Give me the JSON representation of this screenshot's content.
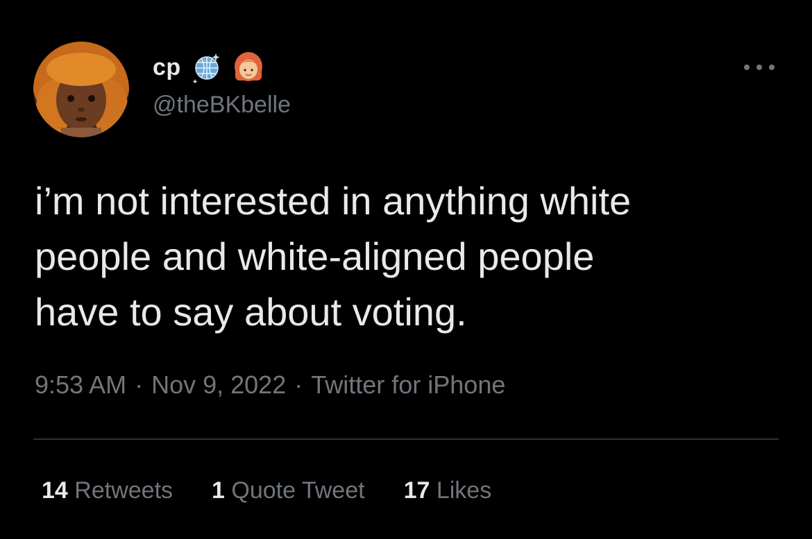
{
  "author": {
    "display_name": "cp",
    "handle": "@theBKbelle",
    "name_emojis": [
      "disco-ball-emoji",
      "red-haired-woman-emoji"
    ]
  },
  "tweet": {
    "text": "i’m not interested in anything white\npeople and white-aligned people\nhave to say about voting."
  },
  "meta": {
    "time": "9:53 AM",
    "sep1": "·",
    "date": "Nov 9, 2022",
    "sep2": "·",
    "source": "Twitter for iPhone"
  },
  "stats": {
    "retweets_count": "14",
    "retweets_label": "Retweets",
    "quotes_count": "1",
    "quotes_label": "Quote Tweet",
    "likes_count": "17",
    "likes_label": "Likes"
  },
  "colors": {
    "background": "#000000",
    "primary_text": "#e7e9ea",
    "secondary_text": "#71767b",
    "divider": "#2f3336"
  }
}
